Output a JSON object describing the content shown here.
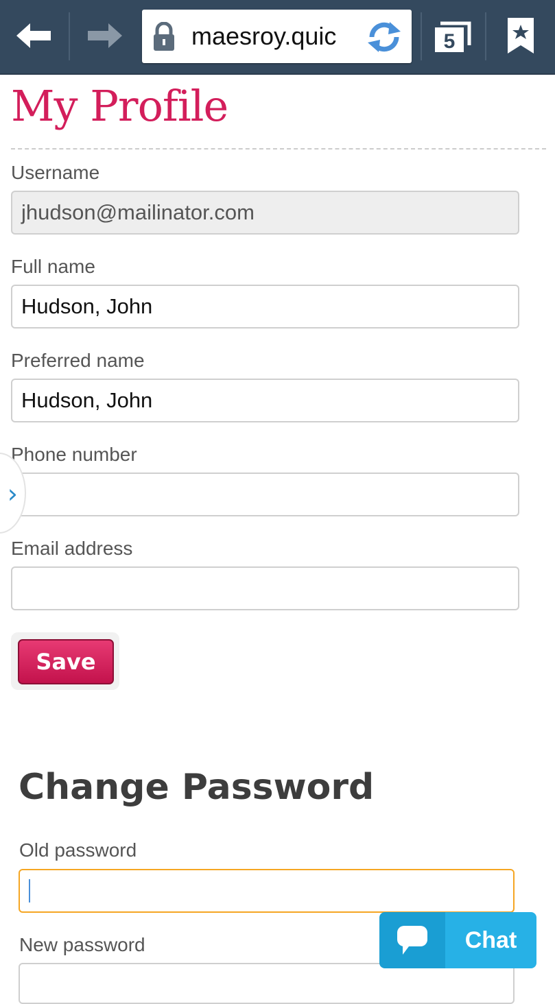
{
  "browser": {
    "url": "maesroy.quic",
    "tab_count": "5"
  },
  "page": {
    "title": "My Profile",
    "fields": {
      "username": {
        "label": "Username",
        "value": "jhudson@mailinator.com"
      },
      "full_name": {
        "label": "Full name",
        "value": "Hudson, John"
      },
      "preferred_name": {
        "label": "Preferred name",
        "value": "Hudson, John"
      },
      "phone": {
        "label": "Phone number",
        "value": ""
      },
      "email": {
        "label": "Email address",
        "value": ""
      }
    },
    "save_label": "Save"
  },
  "change_password": {
    "title": "Change Password",
    "old_password_label": "Old password",
    "new_password_label": "New password"
  },
  "chat": {
    "label": "Chat"
  },
  "colors": {
    "toolbar": "#34495e",
    "accent": "#d31e5b",
    "chat": "#27b1e6",
    "focus": "#f5a623"
  }
}
